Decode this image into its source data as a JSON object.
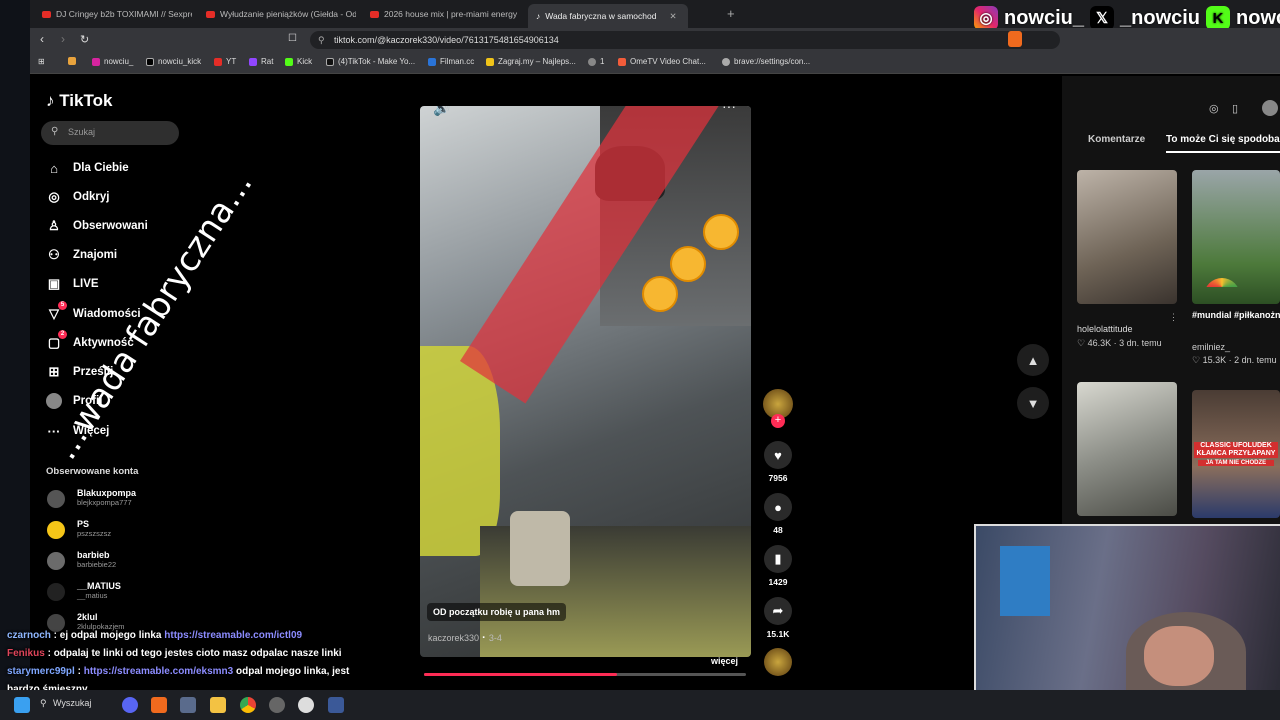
{
  "browser": {
    "tabs": [
      {
        "label": "DJ Cringey b2b TOXIMAMI // Sexpre"
      },
      {
        "label": "Wyłudzanie pieniążków (Giełda - Od"
      },
      {
        "label": "2026 house mix | pre-miami energy"
      },
      {
        "label": "Wada fabryczna w samochod",
        "active": true
      }
    ],
    "new_tab": "+",
    "url": "tiktok.com/@kaczorek330/video/7613175481654906134",
    "bookmarks": [
      "nowciu_",
      "nowciu_kick",
      "YT",
      "Rat",
      "Kick",
      "(4)TikTok - Make Yo...",
      "Filman.cc",
      "Zagraj.my – Najleps...",
      "1",
      "OmeTV Video Chat...",
      "brave://settings/con..."
    ]
  },
  "social_overlay": {
    "instagram": "nowciu_",
    "x": "_nowciu",
    "kick": "nowciu"
  },
  "tiktok": {
    "logo": "TikTok",
    "search_placeholder": "Szukaj",
    "nav": [
      {
        "label": "Dla Ciebie",
        "icon": "home-icon"
      },
      {
        "label": "Odkryj",
        "icon": "compass-icon"
      },
      {
        "label": "Obserwowani",
        "icon": "user-follow-icon"
      },
      {
        "label": "Znajomi",
        "icon": "friends-icon"
      },
      {
        "label": "LIVE",
        "icon": "live-icon"
      },
      {
        "label": "Wiadomości",
        "icon": "message-icon",
        "badge": "5"
      },
      {
        "label": "Aktywność",
        "icon": "activity-icon",
        "badge": "2"
      },
      {
        "label": "Prześlij",
        "icon": "upload-icon"
      },
      {
        "label": "Profil",
        "icon": "profile-icon"
      },
      {
        "label": "Więcej",
        "icon": "more-icon"
      }
    ],
    "followed_title": "Obserwowane konta",
    "followed": [
      {
        "name": "Blakuxpompa",
        "handle": "blejkxpompa777"
      },
      {
        "name": "PS",
        "handle": "pszszszsz"
      },
      {
        "name": "barbieb",
        "handle": "barbiebie22"
      },
      {
        "name": "__MATIUS",
        "handle": "__matius"
      },
      {
        "name": "2klul",
        "handle": "2klulpokazjem"
      }
    ],
    "video": {
      "overlay_text": "...wada fabryczna...",
      "caption": "OD początku robię u pana hm",
      "author": "kaczorek330",
      "date": "3-4",
      "more": "więcej",
      "progress": 0.6
    },
    "actions": {
      "likes": "7956",
      "comments": "48",
      "saves": "1429",
      "shares": "15.1K"
    },
    "right_panel": {
      "tabs": [
        "Komentarze",
        "To może Ci się spodobać"
      ],
      "thumbs": [
        {
          "author": "holelolattitude",
          "likes": "46.3K",
          "age": "3 dn. temu"
        },
        {
          "title": "#mundial #piłkanożna #dc...",
          "author": "emilniez_",
          "likes": "15.3K",
          "age": "2 dn. temu"
        },
        {
          "overlay": ""
        },
        {
          "overlay": "CLASSIC UFOLUDEK KŁAMCA PRZYŁAPANY",
          "sub": "JA TAM NIE CHODZE"
        }
      ]
    }
  },
  "chat": [
    {
      "user": "czarnoch",
      "text": "ej odpal mojego linka",
      "link": "https://streamable.com/ictl09"
    },
    {
      "user": "Fenikus",
      "text": "odpalaj te linki od tego jestes cioto masz odpalac nasze linki"
    },
    {
      "user": "starymerc99pl",
      "link": "https://streamable.com/eksmn3",
      "text": "odpal mojego linka, jest bardzo śmieszny"
    }
  ],
  "taskbar": {
    "search": "Wyszukaj"
  },
  "colors": {
    "accent": "#fe2c55",
    "bg": "#000000",
    "panel": "#121212"
  }
}
